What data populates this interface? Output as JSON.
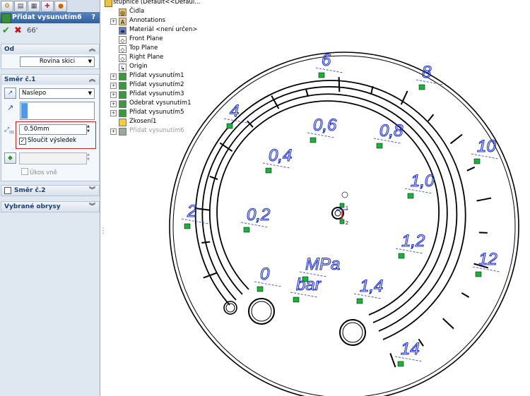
{
  "left_panel": {
    "tabs": [
      "feature-manager",
      "property-manager",
      "configuration-manager",
      "dimxpert",
      "display-manager"
    ],
    "title": "Přidat vysunutím6",
    "help": "?",
    "ok_symbol": "✔",
    "cancel_symbol": "✖",
    "od": {
      "header": "Od",
      "value": "Rovina skici"
    },
    "smer1": {
      "header": "Směr č.1",
      "end_condition": "Naslepo",
      "depth": "0.50mm",
      "merge_label": "Sloučit výsledek",
      "merge_checked": true,
      "draft_label": "Úkos vně"
    },
    "smer2": {
      "header": "Směr č.2"
    },
    "obrysy": {
      "header": "Vybrané obrysy"
    }
  },
  "tree": {
    "root": "stupnice  (Default<<Defaul...",
    "items": [
      "Čidla",
      "Annotations",
      "Materiál <není určen>",
      "Front Plane",
      "Top Plane",
      "Right Plane",
      "Origin",
      "Přidat vysunutím1",
      "Přidat vysunutím2",
      "Přidat vysunutím3",
      "Odebrat vysunutím1",
      "Přidat vysunutím5",
      "Zkosení1",
      "Přidat vysunutím6"
    ]
  },
  "gauge": {
    "outer_labels": [
      "2",
      "4",
      "6",
      "8",
      "10",
      "12",
      "14"
    ],
    "inner_labels": [
      "0",
      "0,2",
      "0,4",
      "0,6",
      "0,8",
      "1,0",
      "1,2",
      "1,4"
    ],
    "unit_mpa": "MPa",
    "unit_bar": "bar",
    "origin_marks": [
      "1",
      "2"
    ]
  },
  "colors": {
    "sketch": "#1d2fd1",
    "relation": "#19b33a",
    "panel": "#dfe7f1",
    "highlight": "#d02020"
  }
}
